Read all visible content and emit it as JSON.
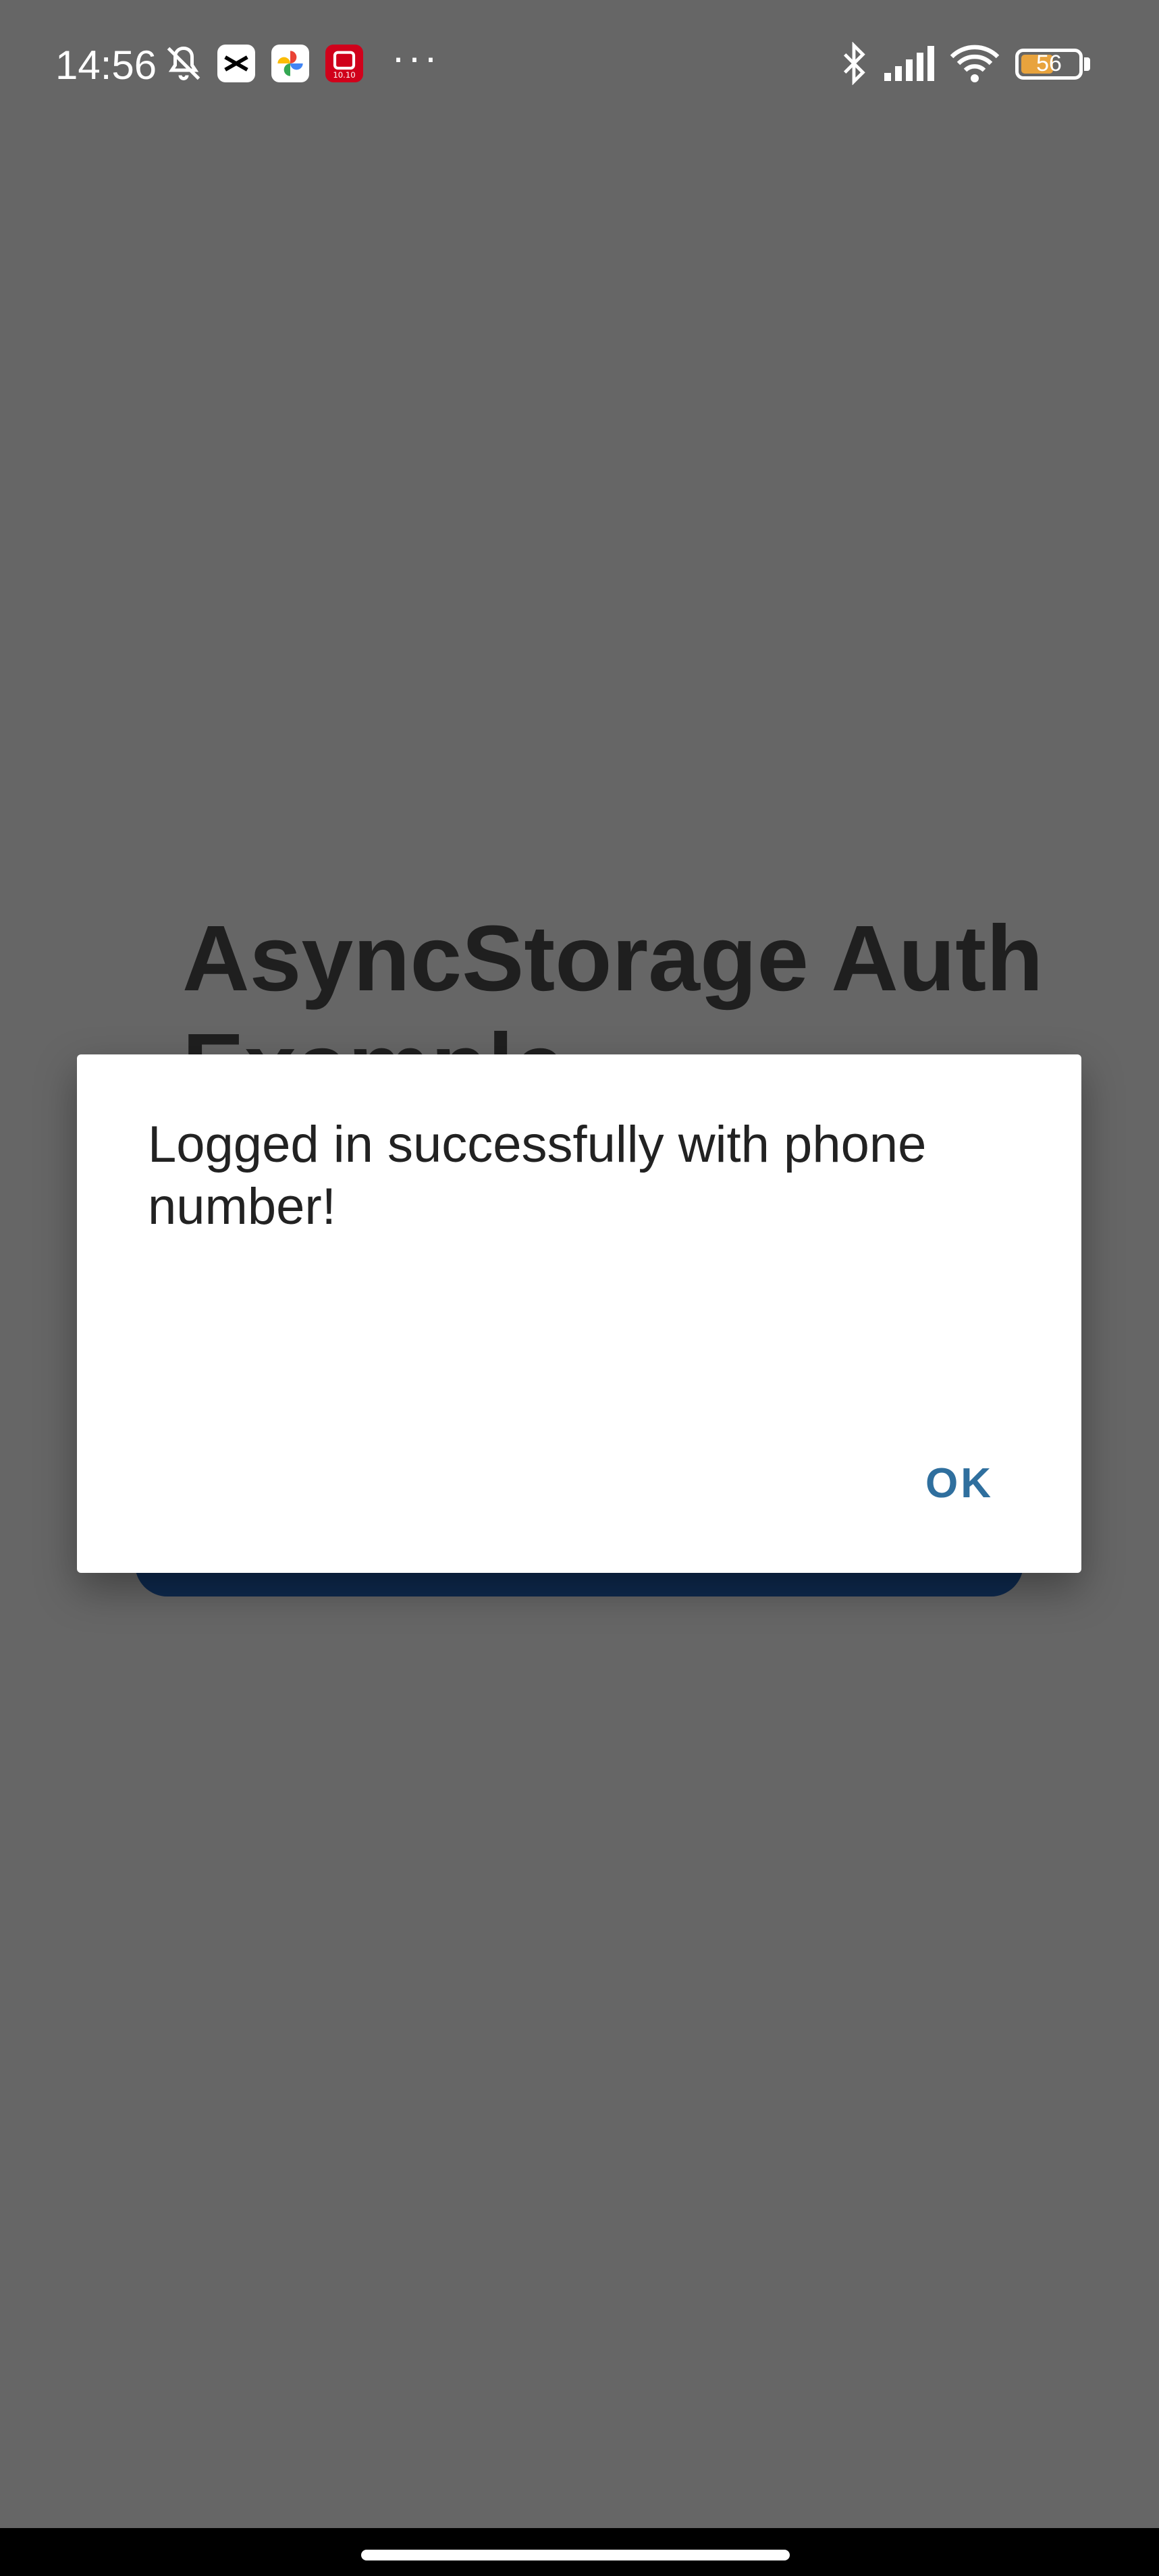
{
  "status_bar": {
    "time": "14:56",
    "battery_level": "56",
    "battery_fraction": 0.56,
    "icons": [
      "bell-off-icon",
      "capcut-icon",
      "photos-icon",
      "shopee-icon",
      "more-dots-icon",
      "bluetooth-icon",
      "signal-icon",
      "wifi-icon",
      "battery-icon"
    ],
    "more": "···",
    "shopee_badge": "10.10"
  },
  "background_app": {
    "title": "AsyncStorage Auth Example"
  },
  "dialog": {
    "message": "Logged in successfully with phone number!",
    "ok_label": "OK"
  },
  "colors": {
    "overlay": "#666666",
    "dialog_bg": "#ffffff",
    "ok_button": "#2f6f9e",
    "app_button": "#0e2a4f",
    "battery_fill": "#e8a33d"
  }
}
